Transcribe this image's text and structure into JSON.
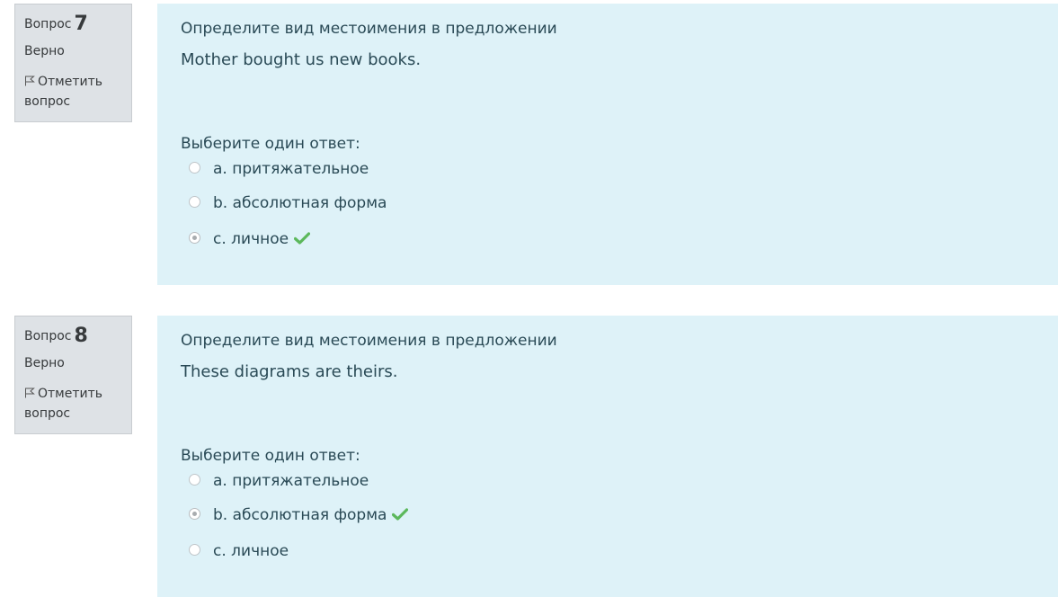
{
  "questions": [
    {
      "label": "Вопрос",
      "number": "7",
      "state": "Верно",
      "flag_label": "Отметить вопрос",
      "question_text": "Определите вид местоимения в предложении",
      "sentence": "Mother bought us new books.",
      "prompt": "Выберите один ответ:",
      "answers": [
        {
          "text": "a. притяжательное",
          "selected": false,
          "correct": false
        },
        {
          "text": "b. абсолютная форма",
          "selected": false,
          "correct": false
        },
        {
          "text": "c. личное",
          "selected": true,
          "correct": true
        }
      ]
    },
    {
      "label": "Вопрос",
      "number": "8",
      "state": "Верно",
      "flag_label": "Отметить вопрос",
      "question_text": "Определите вид местоимения в предложении",
      "sentence": "These diagrams are theirs.",
      "prompt": "Выберите один ответ:",
      "answers": [
        {
          "text": "a. притяжательное",
          "selected": false,
          "correct": false
        },
        {
          "text": "b. абсолютная форма",
          "selected": true,
          "correct": true
        },
        {
          "text": "c. личное",
          "selected": false,
          "correct": false
        }
      ]
    }
  ],
  "colors": {
    "content_bg": "#def2f8",
    "info_bg": "#dee2e6",
    "correct": "#5cb85c"
  },
  "icons": {
    "flag": "flag-icon",
    "correct": "check-icon"
  }
}
